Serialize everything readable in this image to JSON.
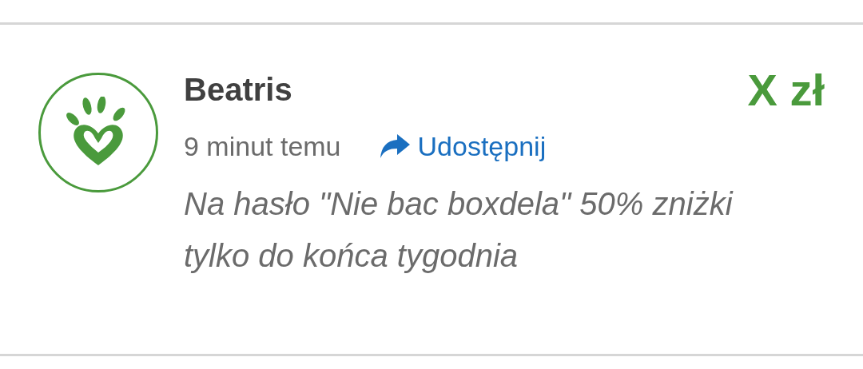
{
  "comment": {
    "author": "Beatris",
    "amount": "X zł",
    "time": "9 minut temu",
    "share_label": "Udostępnij",
    "message": "Na hasło \"Nie bac boxdela\" 50% zniżki tylko do końca tygodnia"
  }
}
